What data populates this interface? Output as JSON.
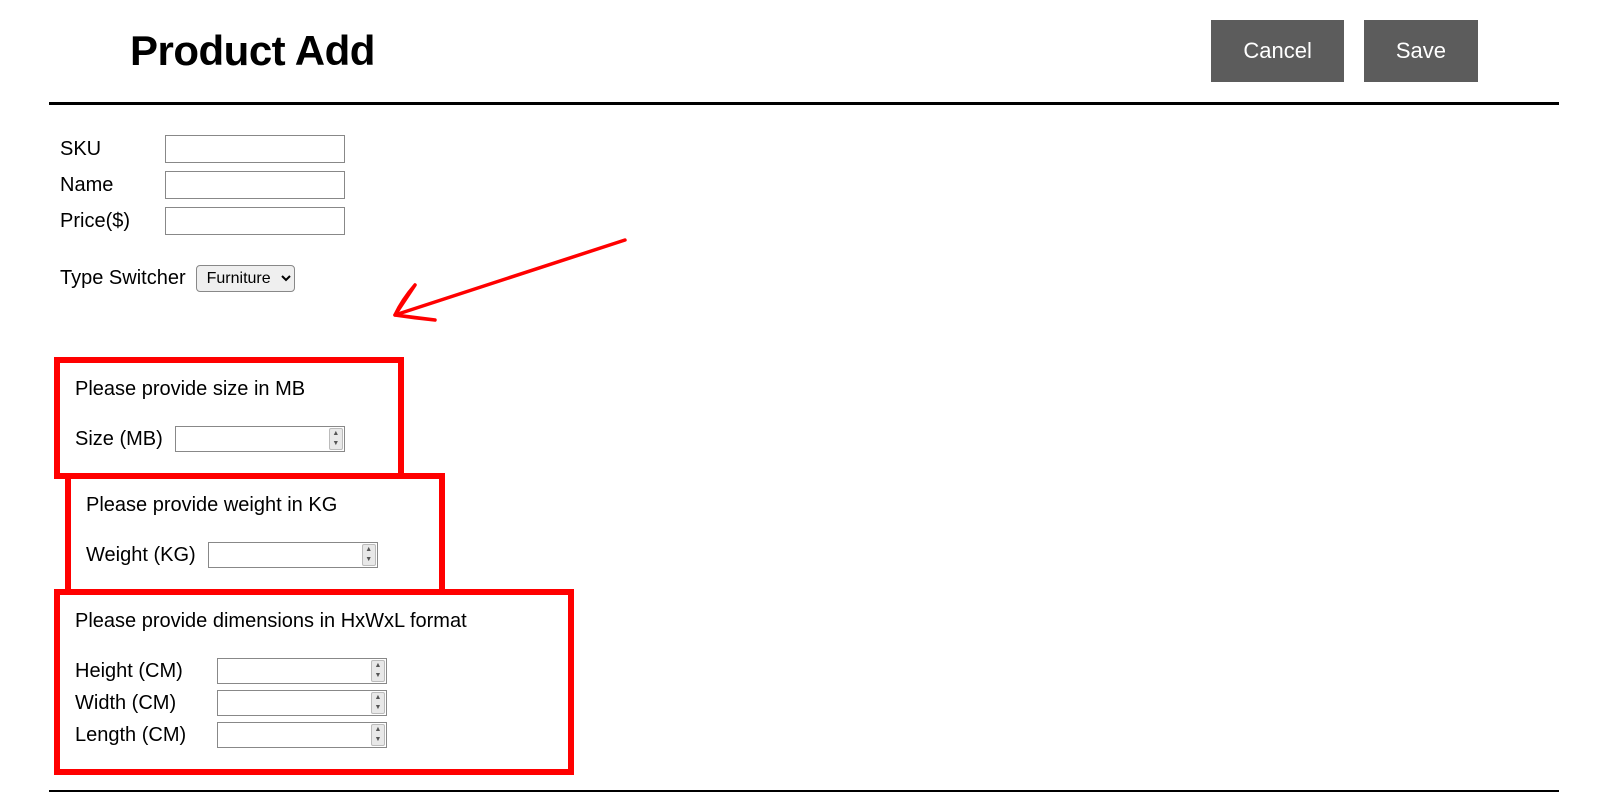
{
  "header": {
    "title": "Product Add",
    "cancel_label": "Cancel",
    "save_label": "Save"
  },
  "fields": {
    "sku_label": "SKU",
    "sku_value": "",
    "name_label": "Name",
    "name_value": "",
    "price_label": "Price($)",
    "price_value": ""
  },
  "type_switcher": {
    "label": "Type Switcher",
    "selected": "Furniture"
  },
  "size_block": {
    "hint": "Please provide size in MB",
    "label": "Size (MB)",
    "value": ""
  },
  "weight_block": {
    "hint": "Please provide weight in KG",
    "label": "Weight (KG)",
    "value": ""
  },
  "dimensions_block": {
    "hint": "Please provide dimensions in HxWxL format",
    "height_label": "Height (CM)",
    "height_value": "",
    "width_label": "Width (CM)",
    "width_value": "",
    "length_label": "Length (CM)",
    "length_value": ""
  },
  "annotation": {
    "arrow_color": "#ff0000"
  }
}
